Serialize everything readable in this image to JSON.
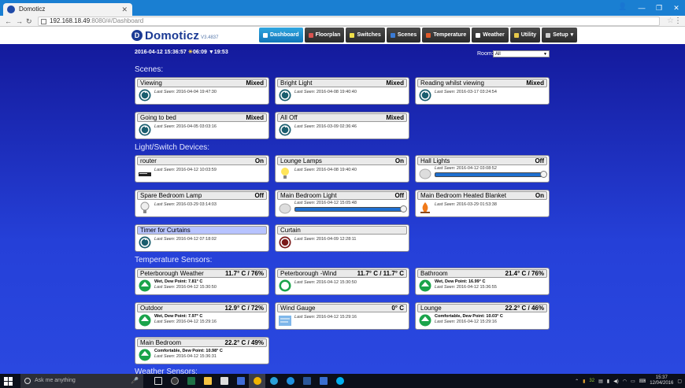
{
  "browser": {
    "tab_title": "Domoticz",
    "url_host": "192.168.18.49",
    "url_rest": ":8080/#/Dashboard"
  },
  "app": {
    "logo_text": "Domoticz",
    "logo_sub": "V3.4837",
    "nav": [
      {
        "label": "Dashboard",
        "icon": "dashboard-icon",
        "color": "#ffffff"
      },
      {
        "label": "Floorplan",
        "icon": "floorplan-icon",
        "color": "#d9534f"
      },
      {
        "label": "Switches",
        "icon": "bulb-icon",
        "color": "#f0e04a"
      },
      {
        "label": "Scenes",
        "icon": "scenes-icon",
        "color": "#3a7bd5"
      },
      {
        "label": "Temperature",
        "icon": "thermometer-icon",
        "color": "#e05a2a"
      },
      {
        "label": "Weather",
        "icon": "weather-icon",
        "color": "#ffffff"
      },
      {
        "label": "Utility",
        "icon": "utility-icon",
        "color": "#e6c84a"
      },
      {
        "label": "Setup",
        "icon": "setup-icon",
        "color": "#cccccc"
      }
    ]
  },
  "header": {
    "datetime": "2016-04-12 15:36:57",
    "sunrise": "06:09",
    "sunset": "19:53",
    "room_label": "Room:",
    "room_value": "All"
  },
  "sections": {
    "scenes": "Scenes:",
    "lights": "Light/Switch Devices:",
    "temps": "Temperature Sensors:",
    "weather": "Weather Sensors:"
  },
  "cards": {
    "s1": {
      "name": "Viewing",
      "status": "Mixed",
      "last": "2016-04-04 19:47:30"
    },
    "s2": {
      "name": "Bright Light",
      "status": "Mixed",
      "last": "2016-04-08 19:40:40"
    },
    "s3": {
      "name": "Reading whilst viewing",
      "status": "Mixed",
      "last": "2016-03-17 03:24:54"
    },
    "s4": {
      "name": "Going to bed",
      "status": "Mixed",
      "last": "2016-04-05 03:03:16"
    },
    "s5": {
      "name": "All Off",
      "status": "Mixed",
      "last": "2016-03-09 02:36:46"
    },
    "l1": {
      "name": "router",
      "status": "On",
      "last": "2016-04-12 10:03:59"
    },
    "l2": {
      "name": "Lounge Lamps",
      "status": "On",
      "last": "2016-04-08 19:40:40"
    },
    "l3": {
      "name": "Hall Lights",
      "status": "Off",
      "last": "2016-04-12 03:08:52",
      "level": 1.0
    },
    "l4": {
      "name": "Spare Bedroom Lamp",
      "status": "Off",
      "last": "2016-03-29 03:14:03"
    },
    "l5": {
      "name": "Main Bedroom Light",
      "status": "Off",
      "last": "2016-04-12 15:05:48",
      "level": 1.0
    },
    "l6": {
      "name": "Main Bedroom Heated Blanket",
      "status": "On",
      "last": "2016-03-29 01:53:38"
    },
    "l7": {
      "name": "Timer for Curtains",
      "status": "",
      "last": "2016-04-12 07:18:02"
    },
    "l8": {
      "name": "Curtain",
      "status": "",
      "last": "2016-04-09 12:28:11"
    },
    "t1": {
      "name": "Peterborough Weather",
      "status": "11.7° C / 76%",
      "sub": "Wet, Dew Point: 7.81° C",
      "last": "2016-04-12 15:30:50"
    },
    "t2": {
      "name": "Peterborough -Wind",
      "status": "11.7° C / 11.7° C",
      "sub": "",
      "last": "2016-04-12 15:30:50"
    },
    "t3": {
      "name": "Bathroom",
      "status": "21.4° C / 76%",
      "sub": "Wet, Dew Point: 16.99° C",
      "last": "2016-04-12 15:36:55"
    },
    "t4": {
      "name": "Outdoor",
      "status": "12.9° C / 72%",
      "sub": "Wet, Dew Point: 7.97° C",
      "last": "2016-04-12 15:29:16"
    },
    "t5": {
      "name": "Wind Gauge",
      "status": "0° C",
      "sub": "",
      "last": "2016-04-12 15:29:16"
    },
    "t6": {
      "name": "Lounge",
      "status": "22.2° C / 46%",
      "sub": "Comfortable, Dew Point: 10.03° C",
      "last": "2016-04-12 15:29:16"
    },
    "t7": {
      "name": "Main Bedroom",
      "status": "22.2° C / 49%",
      "sub": "Comfortable, Dew Point: 10.98° C",
      "last": "2016-04-12 15:36:31"
    }
  },
  "last_seen_label": "Last Seen:",
  "taskbar": {
    "search_placeholder": "Ask me anything",
    "time": "15:37",
    "date": "12/04/2016",
    "badge": "32"
  }
}
